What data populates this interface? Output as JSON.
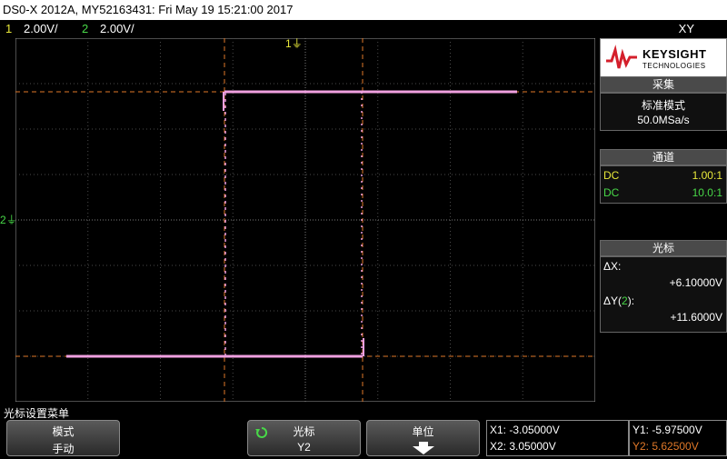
{
  "title": "DS0-X 2012A, MY52163431: Fri May 19 15:21:00 2017",
  "channels": {
    "ch1_num": "1",
    "ch1_scale": "2.00V/",
    "ch2_num": "2",
    "ch2_scale": "2.00V/",
    "mode": "XY"
  },
  "markers": {
    "ch1": "1",
    "ch2": "2"
  },
  "panel": {
    "brand": "KEYSIGHT",
    "brand_sub": "TECHNOLOGIES",
    "acq_head": "采集",
    "acq_mode": "标准模式",
    "acq_rate": "50.0MSa/s",
    "chan_head": "通道",
    "ch1_coupling": "DC",
    "ch1_probe": "1.00:1",
    "ch2_coupling": "DC",
    "ch2_probe": "10.0:1",
    "cursor_head": "光标",
    "dx_label": "ΔX:",
    "dx_value": "+6.10000V",
    "dy_label": "ΔY(",
    "dy_chan": "2",
    "dy_label_end": "):",
    "dy_value": "+11.6000V"
  },
  "softkeys": {
    "menu_title": "光标设置菜单",
    "mode_l1": "模式",
    "mode_l2": "手动",
    "cursor_l1": "光标",
    "cursor_l2": "Y2",
    "unit_l1": "单位",
    "x1": "X1: -3.05000V",
    "x2": "X2: 3.05000V",
    "y1": "Y1: -5.97500V",
    "y2": "Y2: 5.62500V"
  },
  "colors": {
    "ch1": "#e8e83a",
    "ch2": "#48d848",
    "trace": "#f0a0e0",
    "cursor": "#e07828"
  }
}
